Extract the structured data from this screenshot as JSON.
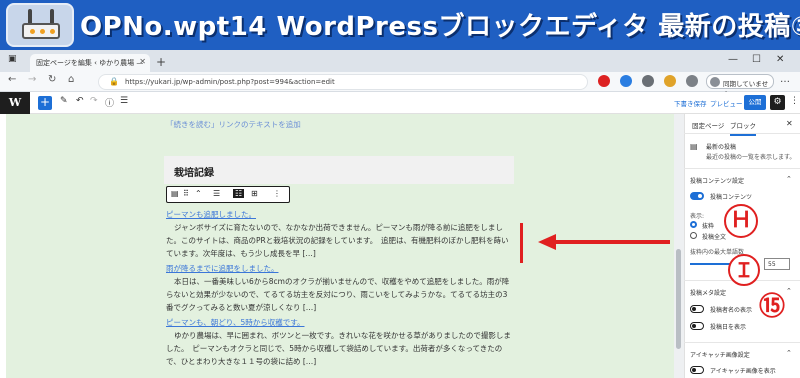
{
  "banner": {
    "title": "OPNo.wpt14  WordPressブロックエディタ  最新の投稿③"
  },
  "browser": {
    "tab_title": "固定ページを編集 ‹ ゆかり農場 —",
    "url": "https://yukari.jp/wp-admin/post.php?post=994&action=edit",
    "sync_label": "同期していません",
    "icons": [
      "back-icon",
      "forward-icon",
      "refresh-icon",
      "home-icon",
      "lock-icon",
      "menu-icon"
    ]
  },
  "wp_toolbar": {
    "logo": "W",
    "add": "+",
    "draft": "下書き保存",
    "preview": "プレビュー",
    "publish": "公開",
    "icons": [
      "pencil-icon",
      "undo-icon",
      "redo-icon",
      "info-icon",
      "list-view-icon",
      "gear-icon"
    ]
  },
  "editor": {
    "readmore_label": "「続きを読む」リンクのテキストを追加",
    "heading": "栽培記録",
    "posts": [
      {
        "title": "ピーマンも追肥しました。",
        "excerpt": "ジャンボサイズに育たないので、なかなか出荷できません。ピーマンも雨が降る前に追肥をしました。このサイトは、商品のPRと栽培状況の記録をしています。　追肥は、有機肥料のぼかし肥料を蒔いています。次年度は、もう少し成長を早 […]"
      },
      {
        "title": "雨が降るまでに追肥をしました。",
        "excerpt": "本日は、一番美味しい6から8cmのオクラが揃いませんので、収穫をやめて追肥をしました。雨が降らないと効果が少ないので、てるてる坊主を反対につり、雨こいをしてみようかな。てるてる坊主の3番でグクってみると数い夏が涼しくなり […]"
      },
      {
        "title": "ピーマンも、朝どり、5時から収穫です。",
        "excerpt": "ゆかり農場は、早に囲まれ、ボツンと一枚です。きれいな花を咲かせる草がありましたので撮影しました。　ピーマンもオクラと同じで、5時から収穫して袋詰めしています。出荷者が多くなってきたので、ひとまわり大きな１１号の袋に詰め […]"
      }
    ]
  },
  "sidebar": {
    "tab_page": "固定ページ",
    "tab_block": "ブロック",
    "block_name": "最新の投稿",
    "block_desc": "最近の投稿の一覧を表示します。",
    "section_content": "投稿コンテンツ設定",
    "toggle_content": "投稿コンテンツ",
    "display_label": "表示:",
    "radio_excerpt": "抜粋",
    "radio_full": "投稿全文",
    "max_words_label": "抜粋内の最大単語数",
    "max_words_value": "55",
    "max_words_fraction": 0.9,
    "section_meta": "投稿メタ設定",
    "toggle_author": "投稿者名の表示",
    "toggle_date": "投稿日を表示",
    "section_featured": "アイキャッチ画像設定",
    "toggle_featured": "アイキャッチ画像を表示"
  },
  "annotations": {
    "mark_h": "Ｈ",
    "mark_i": "Ｉ",
    "mark_15": "⑮"
  },
  "colors": {
    "banner": "#1f5fc2",
    "accent": "#1d6fd6",
    "annotation": "#e02020",
    "canvas": "#e3f1df"
  }
}
